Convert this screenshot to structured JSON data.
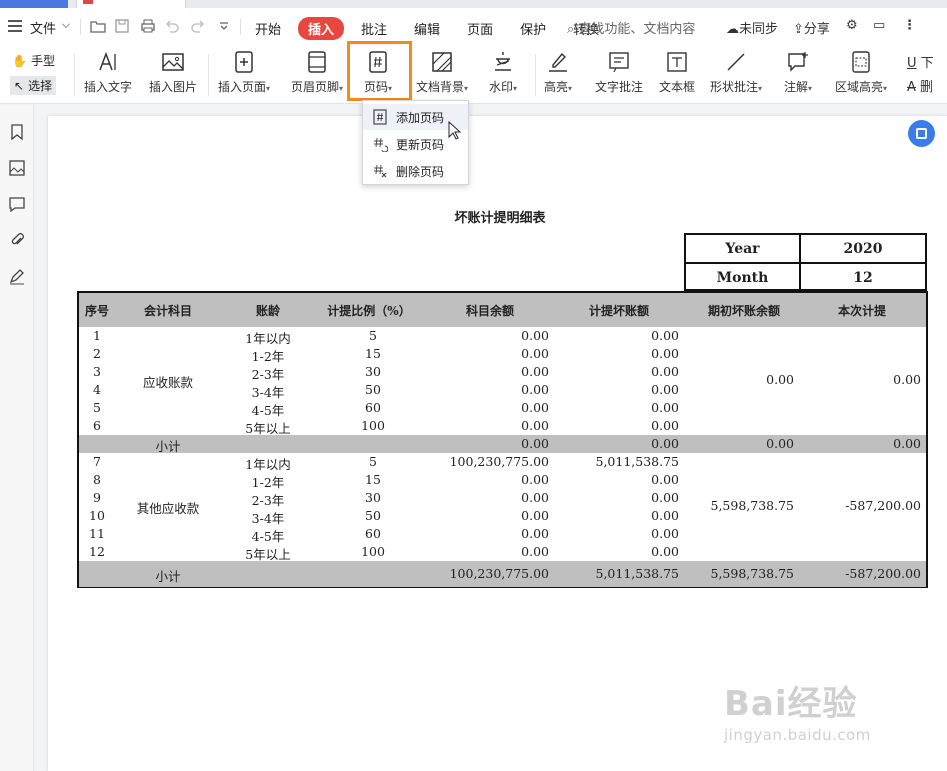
{
  "menubar": {
    "file": "文件",
    "tabs": [
      "开始",
      "插入",
      "批注",
      "编辑",
      "页面",
      "保护",
      "转换"
    ],
    "active_tab": "插入",
    "search_placeholder": "查找功能、文档内容",
    "unsynced": "未同步",
    "share": "分享"
  },
  "ribbon": {
    "hand_tool": "手型",
    "select_tool": "选择",
    "items": [
      {
        "label": "插入文字",
        "icon": "insert-text-icon"
      },
      {
        "label": "插入图片",
        "icon": "insert-image-icon"
      },
      {
        "label": "插入页面",
        "icon": "insert-page-icon"
      },
      {
        "label": "页眉页脚",
        "icon": "header-footer-icon"
      },
      {
        "label": "页码",
        "icon": "page-number-icon"
      },
      {
        "label": "文档背景",
        "icon": "doc-background-icon"
      },
      {
        "label": "水印",
        "icon": "watermark-icon"
      },
      {
        "label": "高亮",
        "icon": "highlight-icon"
      },
      {
        "label": "文字批注",
        "icon": "text-annotation-icon"
      },
      {
        "label": "文本框",
        "icon": "textbox-icon"
      },
      {
        "label": "形状批注",
        "icon": "shape-annotation-icon"
      },
      {
        "label": "注解",
        "icon": "note-icon"
      },
      {
        "label": "区域高亮",
        "icon": "area-highlight-icon"
      },
      {
        "label": "下",
        "icon": "underline-icon"
      },
      {
        "label": "删",
        "icon": "strikethrough-icon"
      }
    ]
  },
  "dropdown": {
    "items": [
      "添加页码",
      "更新页码",
      "删除页码"
    ]
  },
  "document": {
    "title": "坏账计提明细表",
    "year_label": "Year",
    "year_value": "2020",
    "month_label": "Month",
    "month_value": "12",
    "headers": [
      "序号",
      "会计科目",
      "账龄",
      "计提比例（%）",
      "科目余额",
      "计提坏账额",
      "期初坏账余额",
      "本次计提"
    ],
    "groups": [
      {
        "account": "应收账款",
        "rows": [
          {
            "no": "1",
            "age": "1年以内",
            "ratio": "5",
            "balance": "0.00",
            "provision": "0.00"
          },
          {
            "no": "2",
            "age": "1-2年",
            "ratio": "15",
            "balance": "0.00",
            "provision": "0.00"
          },
          {
            "no": "3",
            "age": "2-3年",
            "ratio": "30",
            "balance": "0.00",
            "provision": "0.00"
          },
          {
            "no": "4",
            "age": "3-4年",
            "ratio": "50",
            "balance": "0.00",
            "provision": "0.00"
          },
          {
            "no": "5",
            "age": "4-5年",
            "ratio": "60",
            "balance": "0.00",
            "provision": "0.00"
          },
          {
            "no": "6",
            "age": "5年以上",
            "ratio": "100",
            "balance": "0.00",
            "provision": "0.00"
          }
        ],
        "opening": "0.00",
        "current": "0.00",
        "subtotal": {
          "label": "小计",
          "balance": "0.00",
          "provision": "0.00",
          "opening": "0.00",
          "current": "0.00"
        }
      },
      {
        "account": "其他应收款",
        "rows": [
          {
            "no": "7",
            "age": "1年以内",
            "ratio": "5",
            "balance": "100,230,775.00",
            "provision": "5,011,538.75"
          },
          {
            "no": "8",
            "age": "1-2年",
            "ratio": "15",
            "balance": "0.00",
            "provision": "0.00"
          },
          {
            "no": "9",
            "age": "2-3年",
            "ratio": "30",
            "balance": "0.00",
            "provision": "0.00"
          },
          {
            "no": "10",
            "age": "3-4年",
            "ratio": "50",
            "balance": "0.00",
            "provision": "0.00"
          },
          {
            "no": "11",
            "age": "4-5年",
            "ratio": "60",
            "balance": "0.00",
            "provision": "0.00"
          },
          {
            "no": "12",
            "age": "5年以上",
            "ratio": "100",
            "balance": "0.00",
            "provision": "0.00"
          }
        ],
        "opening": "5,598,738.75",
        "current": "-587,200.00",
        "subtotal": {
          "label": "小计",
          "balance": "100,230,775.00",
          "provision": "5,011,538.75",
          "opening": "5,598,738.75",
          "current": "-587,200.00"
        }
      }
    ]
  },
  "watermark": {
    "brand": "Bai经验",
    "url": "jingyan.baidu.com"
  },
  "colors": {
    "active_tab": "#e9463f",
    "highlight_frame": "#f08b1c",
    "table_header": "#bfbfbf",
    "float_button": "#3b7de8"
  }
}
